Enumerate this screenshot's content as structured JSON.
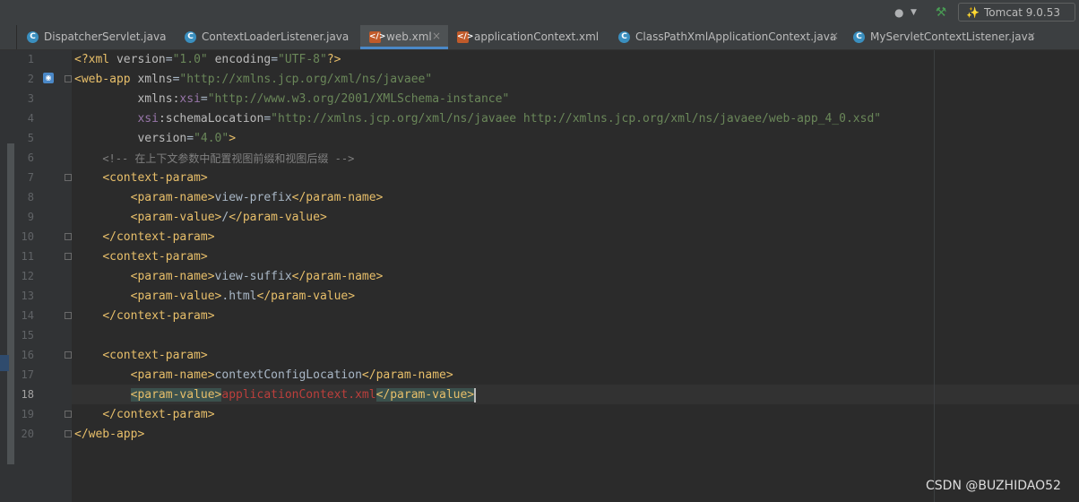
{
  "toolbar": {
    "run_config": "Tomcat 9.0.53"
  },
  "tabs": [
    {
      "label": "DispatcherServlet.java",
      "icon": "class-icon"
    },
    {
      "label": "ContextLoaderListener.java",
      "icon": "class-icon"
    },
    {
      "label": "web.xml",
      "icon": "xml-icon",
      "active": true
    },
    {
      "label": "applicationContext.xml",
      "icon": "xml-icon"
    },
    {
      "label": "ClassPathXmlApplicationContext.java",
      "icon": "class-icon"
    },
    {
      "label": "MyServletContextListener.java",
      "icon": "class-icon"
    }
  ],
  "editor": {
    "current_line": 18,
    "line_numbers": [
      "1",
      "2",
      "3",
      "4",
      "5",
      "6",
      "7",
      "8",
      "9",
      "10",
      "11",
      "12",
      "13",
      "14",
      "15",
      "16",
      "17",
      "18",
      "19",
      "20"
    ],
    "code": {
      "l1_decl": "<?xml",
      "l1_version_attr": "version",
      "l1_version_val": "\"1.0\"",
      "l1_enc_attr": "encoding",
      "l1_enc_val": "\"UTF-8\"",
      "l1_end": "?>",
      "l2_tag": "<web-app",
      "l2_attr": "xmlns",
      "l2_val": "\"http://xmlns.jcp.org/xml/ns/javaee\"",
      "l3_attr": "xmlns:",
      "l3_ns": "xsi",
      "l3_val": "\"http://www.w3.org/2001/XMLSchema-instance\"",
      "l4_ns": "xsi",
      "l4_attr": ":schemaLocation",
      "l4_val": "\"http://xmlns.jcp.org/xml/ns/javaee http://xmlns.jcp.org/xml/ns/javaee/web-app_4_0.xsd\"",
      "l5_attr": "version",
      "l5_val": "\"4.0\"",
      "l5_end": ">",
      "l6_comment": "<!-- 在上下文参数中配置视图前缀和视图后缀 -->",
      "ctx_open": "<context-param>",
      "ctx_close": "</context-param>",
      "pname_open": "<param-name>",
      "pname_close": "</param-name>",
      "pvalue_open": "<param-value>",
      "pvalue_close": "</param-value>",
      "l8_text": "view-prefix",
      "l9_text": "/",
      "l12_text": "view-suffix",
      "l13_text": ".html",
      "l17_text": "contextConfigLocation",
      "l18_text": "applicationContext.xml",
      "l20_tag": "</web-app>"
    }
  },
  "watermark": "CSDN @BUZHIDAO52"
}
